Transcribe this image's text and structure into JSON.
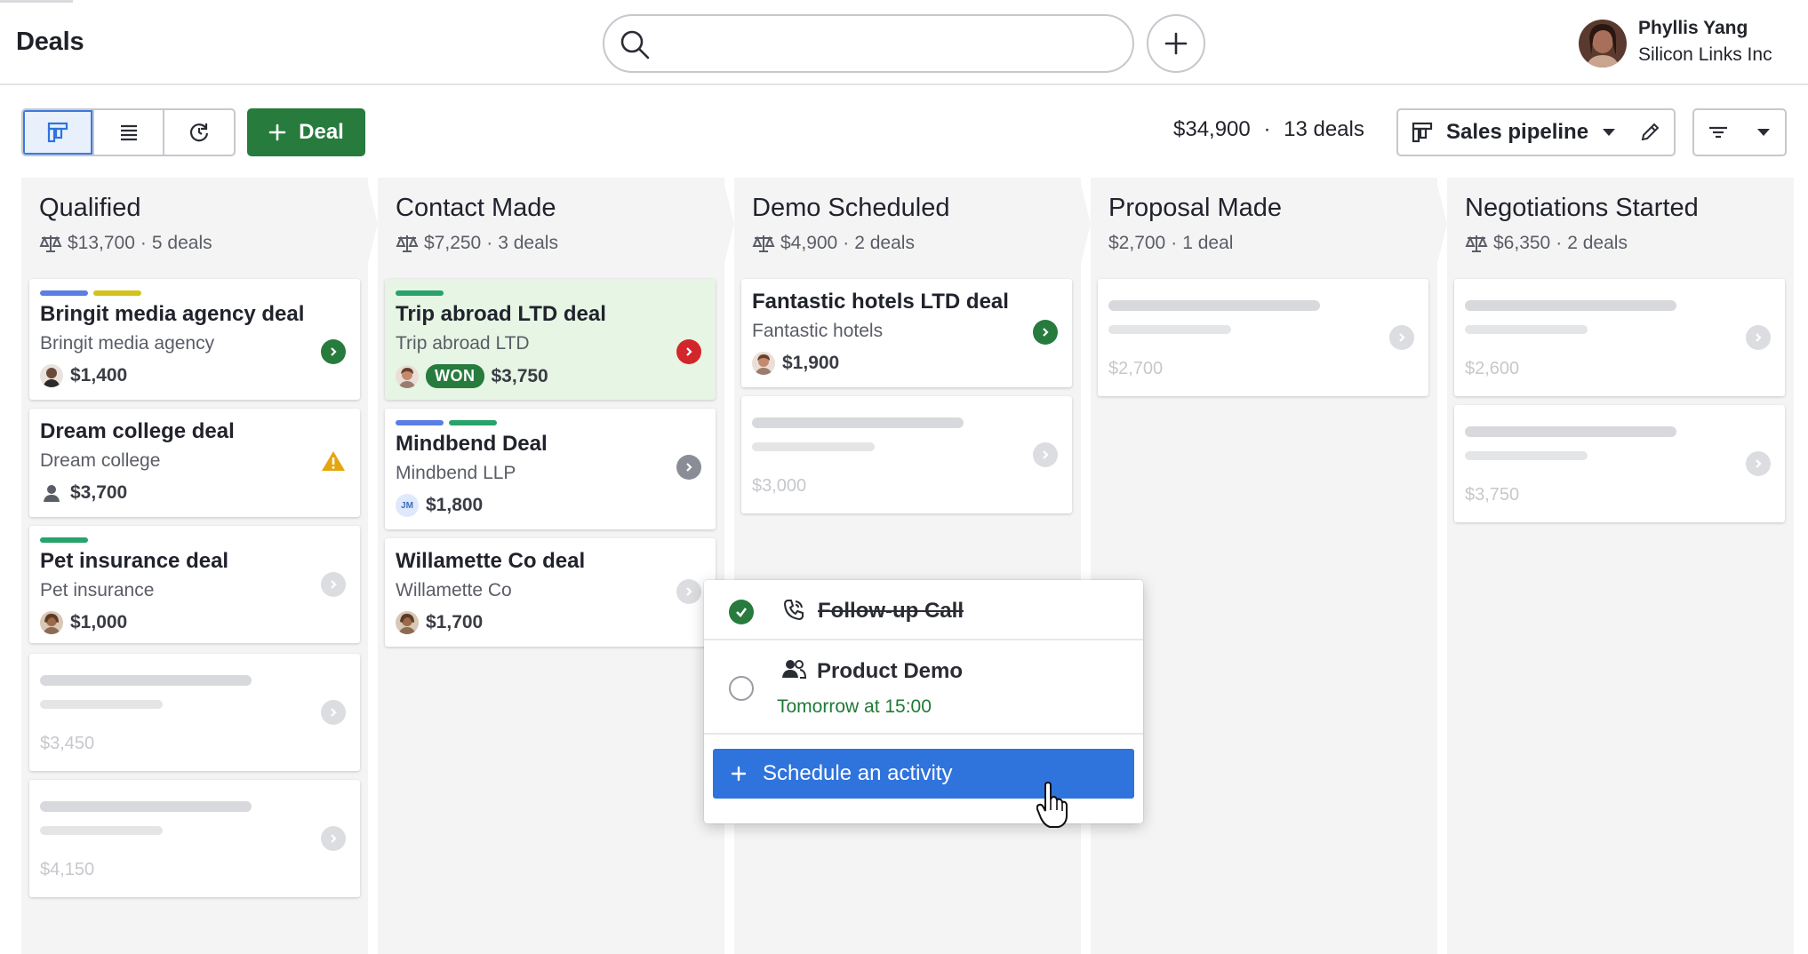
{
  "header": {
    "title": "Deals",
    "search_placeholder": "",
    "user": {
      "name": "Phyllis Yang",
      "company": "Silicon Links Inc"
    }
  },
  "toolbar": {
    "add_label": "Deal",
    "summary_value": "$34,900",
    "summary_sep": "·",
    "summary_count": "13 deals",
    "pipeline_label": "Sales pipeline"
  },
  "colors": {
    "accent_green": "#267b3d",
    "primary_blue": "#2f73dd",
    "danger_red": "#d3262a",
    "won_bg": "#e6f5e4"
  },
  "stages": [
    {
      "name": "Qualified",
      "total": "$13,700",
      "count": "5 deals",
      "weighted_icon": "scale-icon"
    },
    {
      "name": "Contact Made",
      "total": "$7,250",
      "count": "3 deals",
      "weighted_icon": "scale-icon"
    },
    {
      "name": "Demo Scheduled",
      "total": "$4,900",
      "count": "2 deals",
      "weighted_icon": "scale-icon"
    },
    {
      "name": "Proposal Made",
      "total": "$2,700",
      "count": "1 deal",
      "weighted_icon": ""
    },
    {
      "name": "Negotiations Started",
      "total": "$6,350",
      "count": "2 deals",
      "weighted_icon": "scale-icon"
    }
  ],
  "deals": {
    "bringit": {
      "title": "Bringit media agency deal",
      "org": "Bringit media agency",
      "value": "$1,400",
      "status": "green"
    },
    "dream": {
      "title": "Dream college deal",
      "org": "Dream college",
      "value": "$3,700",
      "status": "warning"
    },
    "pet": {
      "title": "Pet insurance deal",
      "org": "Pet insurance",
      "value": "$1,000",
      "status": "none"
    },
    "q4": {
      "value": "$3,450"
    },
    "q5": {
      "value": "$4,150"
    },
    "trip": {
      "title": "Trip abroad LTD deal",
      "org": "Trip abroad LTD",
      "value": "$3,750",
      "badge": "WON",
      "status": "red"
    },
    "mindbend": {
      "title": "Mindbend Deal",
      "org": "Mindbend LLP",
      "value": "$1,800",
      "owner_initials": "JM",
      "status": "grey"
    },
    "willamette": {
      "title": "Willamette Co deal",
      "org": "Willamette Co",
      "value": "$1,700",
      "status": "none"
    },
    "fantastic": {
      "title": "Fantastic hotels LTD deal",
      "org": "Fantastic hotels",
      "value": "$1,900",
      "status": "green"
    },
    "d2": {
      "value": "$3,000"
    },
    "p1": {
      "value": "$2,700"
    },
    "n1": {
      "value": "$2,600"
    },
    "n2": {
      "value": "$3,750"
    }
  },
  "activity_popover": {
    "items": [
      {
        "title": "Follow-up Call",
        "done": true,
        "icon": "phone-icon"
      },
      {
        "title": "Product Demo",
        "done": false,
        "icon": "meeting-icon",
        "when": "Tomorrow at 15:00"
      }
    ],
    "schedule_label": "Schedule an activity"
  }
}
